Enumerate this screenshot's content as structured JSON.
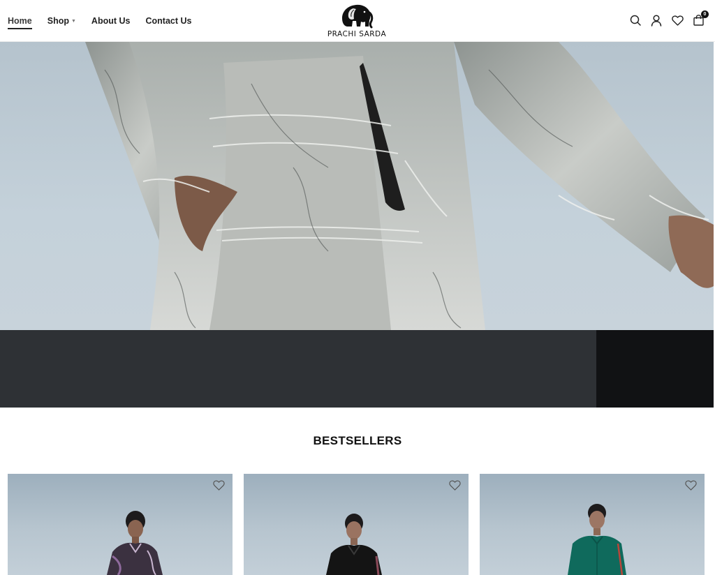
{
  "nav": {
    "items": [
      {
        "label": "Home",
        "active": true
      },
      {
        "label": "Shop",
        "has_dropdown": true
      },
      {
        "label": "About Us"
      },
      {
        "label": "Contact Us"
      }
    ]
  },
  "brand": {
    "name": "PRACHI SARDA",
    "logo_icon": "elephant-icon"
  },
  "header_icons": {
    "search": "search-icon",
    "account": "user-icon",
    "wishlist": "heart-icon",
    "cart": "shopping-bag-icon",
    "cart_count": "0"
  },
  "hero": {
    "image": "model in grey printed co-ord set",
    "background_color": "#c4d1da"
  },
  "bestsellers": {
    "title": "BESTSELLERS",
    "products": [
      {
        "image": "model in multicolour printed shirt",
        "wishlist_icon": "heart-icon",
        "outfit_color": "#3b3140"
      },
      {
        "image": "model in black shirt",
        "wishlist_icon": "heart-icon",
        "outfit_color": "#141414"
      },
      {
        "image": "model in emerald green tunic",
        "wishlist_icon": "heart-icon",
        "outfit_color": "#0f6a5c"
      }
    ]
  },
  "colors": {
    "band": "#2e3135",
    "text": "#1c1c1c",
    "accent": "#000000"
  }
}
